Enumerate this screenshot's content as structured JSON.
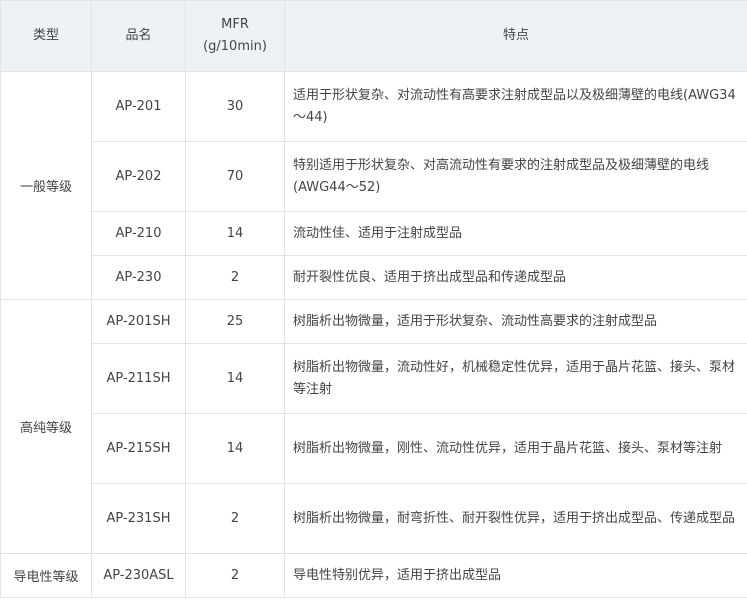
{
  "table": {
    "headers": {
      "type": "类型",
      "name": "品名",
      "mfr_line1": "MFR",
      "mfr_line2": "(g/10min)",
      "features": "特点"
    },
    "groups": [
      {
        "type": "一般等级",
        "rows": [
          {
            "name": "AP-201",
            "mfr": "30",
            "features": "适用于形状复杂、对流动性有高要求注射成型品以及极细薄壁的电线(AWG34～44)"
          },
          {
            "name": "AP-202",
            "mfr": "70",
            "features": "特别适用于形状复杂、对高流动性有要求的注射成型品及极细薄壁的电线(AWG44～52)"
          },
          {
            "name": "AP-210",
            "mfr": "14",
            "features": "流动性佳、适用于注射成型品"
          },
          {
            "name": "AP-230",
            "mfr": "2",
            "features": "耐开裂性优良、适用于挤出成型品和传递成型品"
          }
        ]
      },
      {
        "type": "高纯等级",
        "rows": [
          {
            "name": "AP-201SH",
            "mfr": "25",
            "features": "树脂析出物微量，适用于形状复杂、流动性高要求的注射成型品"
          },
          {
            "name": "AP-211SH",
            "mfr": "14",
            "features": "树脂析出物微量，流动性好，机械稳定性优异，适用于晶片花篮、接头、泵材等注射"
          },
          {
            "name": "AP-215SH",
            "mfr": "14",
            "features": "树脂析出物微量，刚性、流动性优异，适用于晶片花篮、接头、泵材等注射"
          },
          {
            "name": "AP-231SH",
            "mfr": "2",
            "features": "树脂析出物微量，耐弯折性、耐开裂性优异，适用于挤出成型品、传递成型品"
          }
        ]
      },
      {
        "type": "导电性等级",
        "rows": [
          {
            "name": "AP-230ASL",
            "mfr": "2",
            "features": "导电性特别优异，适用于挤出成型品"
          }
        ]
      }
    ]
  }
}
